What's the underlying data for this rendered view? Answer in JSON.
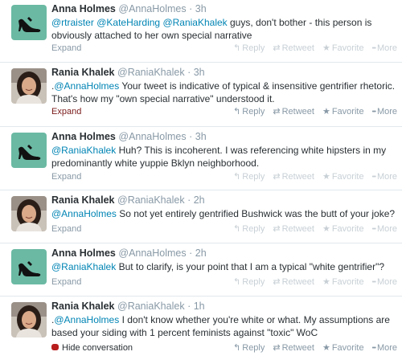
{
  "tweets": [
    {
      "fullname": "Anna Holmes",
      "username": "@AnnaHolmes",
      "dot": "·",
      "time": "3h",
      "segments": [
        {
          "type": "mention",
          "text": "@rtraister"
        },
        {
          "type": "text",
          "text": " "
        },
        {
          "type": "mention",
          "text": "@KateHarding"
        },
        {
          "type": "text",
          "text": " "
        },
        {
          "type": "mention",
          "text": "@RaniaKhalek"
        },
        {
          "type": "text",
          "text": " guys, don't bother - this person is obviously attached to her own special narrative"
        }
      ],
      "footer_link": "Expand",
      "avatar": "anna"
    },
    {
      "fullname": "Rania Khalek",
      "username": "@RaniaKhalek",
      "dot": "·",
      "time": "3h",
      "segments": [
        {
          "type": "text",
          "text": "."
        },
        {
          "type": "mention",
          "text": "@AnnaHolmes"
        },
        {
          "type": "text",
          "text": " Your tweet is indicative of typical & insensitive gentrifier rhetoric. That's how my \"own special narrative\" understood it."
        }
      ],
      "footer_link": "Expand",
      "avatar": "rania"
    },
    {
      "fullname": "Anna Holmes",
      "username": "@AnnaHolmes",
      "dot": "·",
      "time": "3h",
      "segments": [
        {
          "type": "mention",
          "text": "@RaniaKhalek"
        },
        {
          "type": "text",
          "text": " Huh? This is incoherent.   I was referencing white hipsters in my predominantly white yuppie Bklyn neighborhood."
        }
      ],
      "footer_link": "Expand",
      "avatar": "anna"
    },
    {
      "fullname": "Rania Khalek",
      "username": "@RaniaKhalek",
      "dot": "·",
      "time": "2h",
      "segments": [
        {
          "type": "mention",
          "text": "@AnnaHolmes"
        },
        {
          "type": "text",
          "text": " So not yet entirely gentrified Bushwick was the butt of your joke?"
        }
      ],
      "footer_link": "Expand",
      "avatar": "rania"
    },
    {
      "fullname": "Anna Holmes",
      "username": "@AnnaHolmes",
      "dot": "·",
      "time": "2h",
      "segments": [
        {
          "type": "mention",
          "text": "@RaniaKhalek"
        },
        {
          "type": "text",
          "text": " But to clarify, is your point that I am a typical \"white gentrifier\"?"
        }
      ],
      "footer_link": "Expand",
      "avatar": "anna"
    },
    {
      "fullname": "Rania Khalek",
      "username": "@RaniaKhalek",
      "dot": "·",
      "time": "1h",
      "segments": [
        {
          "type": "text",
          "text": "."
        },
        {
          "type": "mention",
          "text": "@AnnaHolmes"
        },
        {
          "type": "text",
          "text": " I don't know whether you're white or what. My assumptions are based your siding with 1 percent feminists against \"toxic\" WoC"
        }
      ],
      "footer_link": "Hide conversation",
      "avatar": "rania"
    }
  ],
  "actions": {
    "reply": "Reply",
    "retweet": "Retweet",
    "favorite": "Favorite",
    "more": "More"
  },
  "colors": {
    "mention": "#0084b4",
    "muted": "#8899a6",
    "text": "#292f33",
    "avatar_teal": "#6bb9a3",
    "hide_icon": "#b81d1d"
  }
}
